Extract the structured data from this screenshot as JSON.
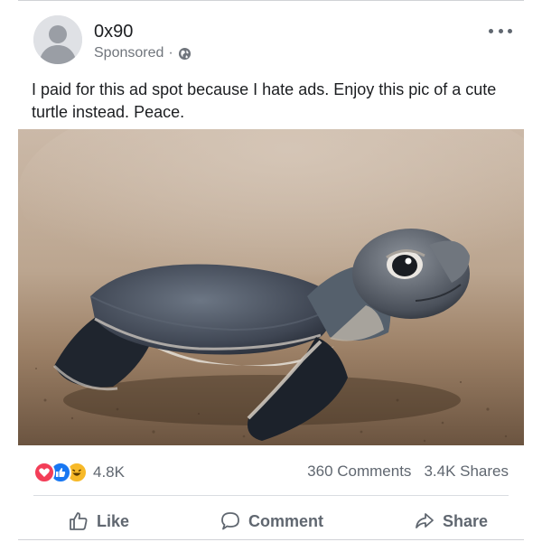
{
  "post": {
    "author": "0x90",
    "sponsored": "Sponsored",
    "separator": "·",
    "text": "I paid for this ad spot because I hate ads. Enjoy this pic of a cute turtle instead. Peace."
  },
  "icons": {
    "avatar": "default-avatar-icon",
    "privacy": "globe-icon",
    "menu": "more-options-icon",
    "reactions": [
      "love-reaction-icon",
      "like-reaction-icon",
      "haha-reaction-icon"
    ],
    "like": "thumbs-up-icon",
    "comment": "speech-bubble-icon",
    "share": "share-arrow-icon"
  },
  "stats": {
    "reactions": "4.8K",
    "comments": "360 Comments",
    "shares": "3.4K Shares"
  },
  "actions": {
    "like": "Like",
    "comment": "Comment",
    "share": "Share"
  },
  "colors": {
    "love": "#f33e58",
    "like": "#1877f2",
    "haha": "#f7b928",
    "text_secondary": "#606770"
  }
}
